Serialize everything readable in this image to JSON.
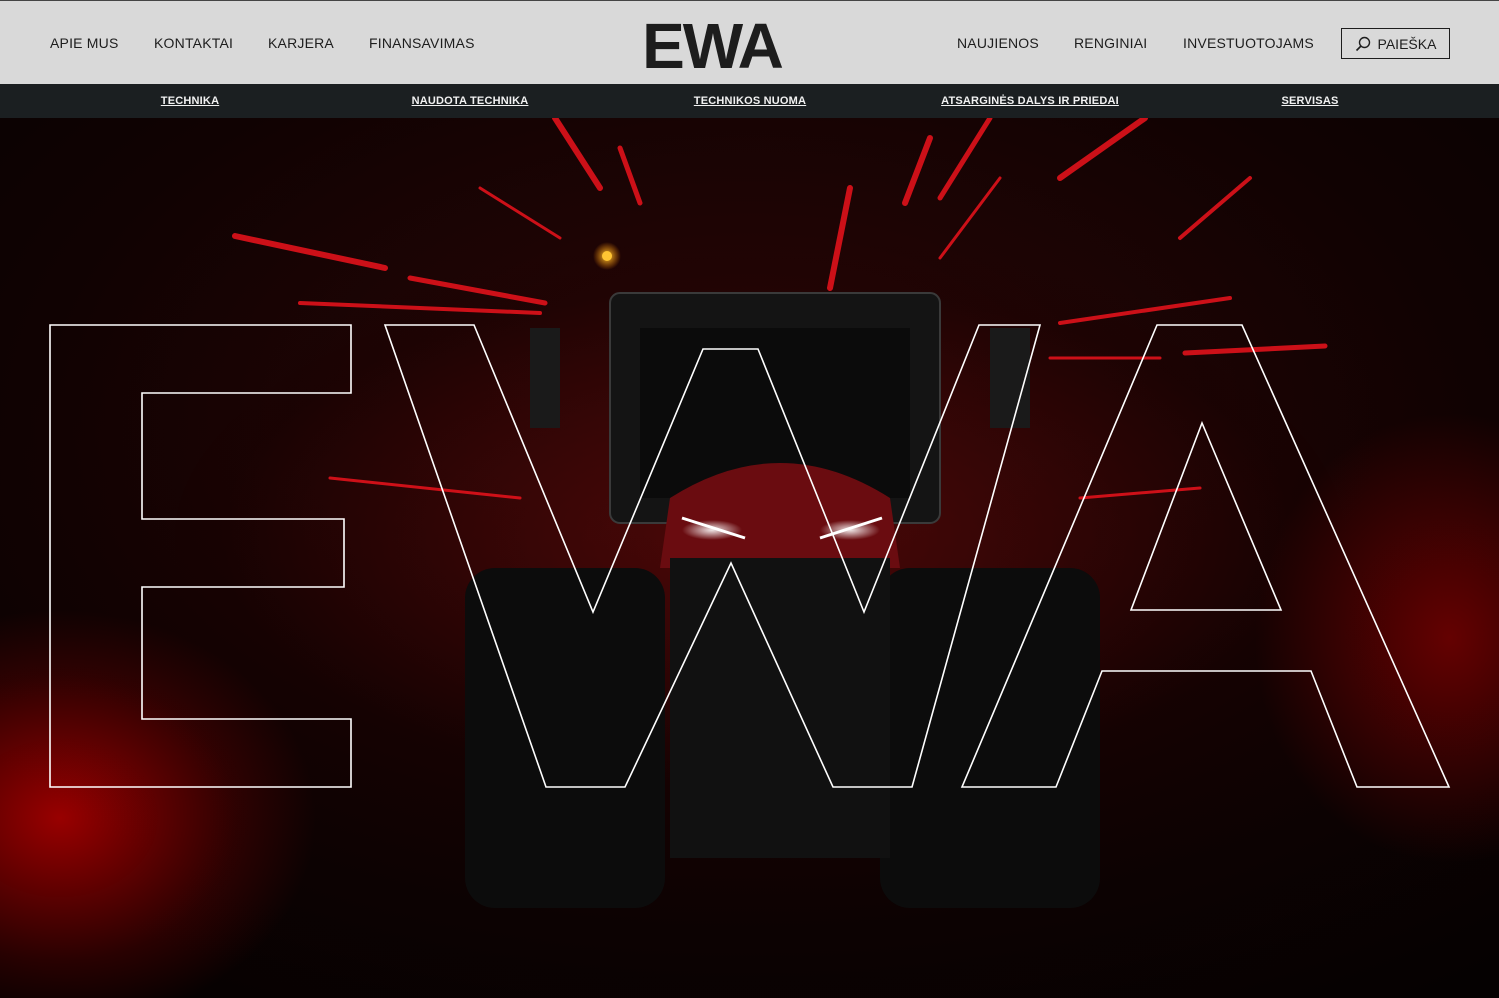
{
  "header": {
    "left_nav": [
      "APIE MUS",
      "KONTAKTAI",
      "KARJERA",
      "FINANSAVIMAS"
    ],
    "logo_text": "EWA",
    "right_nav": [
      "NAUJIENOS",
      "RENGINIAI",
      "INVESTUOTOJAMS"
    ],
    "search_label": "PAIEŠKA",
    "search_icon": "search-icon"
  },
  "subnav": {
    "items": [
      "TECHNIKA",
      "NAUDOTA TECHNIKA",
      "TECHNIKOS NUOMA",
      "ATSARGINĖS DALYS IR PRIEDAI",
      "SERVISAS"
    ]
  },
  "hero": {
    "outline_text": "EWA",
    "image": "tractor-with-red-light-beams",
    "colors": {
      "accent_red": "#e0121b",
      "outline": "#ffffff",
      "topbar_bg": "#d9d9d9",
      "subnav_bg": "#1b1f21"
    }
  }
}
